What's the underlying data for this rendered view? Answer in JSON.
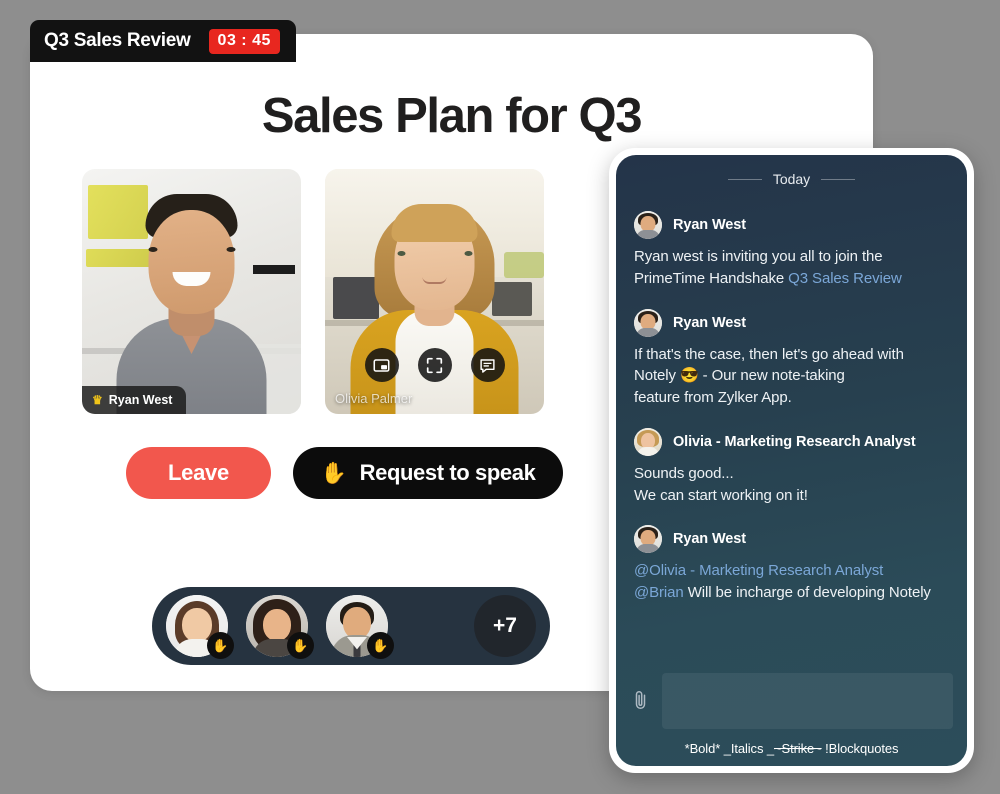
{
  "window": {
    "title": "Q3 Sales Review",
    "timer": "03 : 45"
  },
  "main": {
    "page_title": "Sales Plan for Q3",
    "tiles": [
      {
        "name": "Ryan West",
        "is_host": true,
        "host_icon": "crown-icon"
      },
      {
        "name": "Olivia Palmer",
        "is_host": false
      }
    ],
    "tile_controls": [
      {
        "icon": "picture-in-picture-icon",
        "label": "Picture in picture"
      },
      {
        "icon": "fullscreen-icon",
        "label": "Fullscreen"
      },
      {
        "icon": "chat-icon",
        "label": "Chat"
      }
    ],
    "actions": {
      "leave_label": "Leave",
      "request_label": "Request to speak",
      "request_icon": "raised-hand-icon",
      "leave_color": "#f2574d",
      "request_color": "#0c0c0c"
    },
    "participants": {
      "raised_hand_icon": "raised-hand-icon",
      "overflow_label": "+7",
      "avatars": [
        {
          "name": "Participant 1",
          "hand_raised": true
        },
        {
          "name": "Participant 2",
          "hand_raised": true
        },
        {
          "name": "Participant 3",
          "hand_raised": true
        }
      ]
    }
  },
  "chat": {
    "date_divider": "Today",
    "messages": [
      {
        "author": "Ryan West",
        "avatar": "ryan",
        "text_before": "Ryan  west is inviting you all to join the PrimeTime Handshake ",
        "link": "Q3 Sales Review",
        "text_after": ""
      },
      {
        "author": "Ryan West",
        "avatar": "ryan",
        "line1": "If that's the case, then let's go ahead with",
        "emoji": "😎",
        "line2_a": "Notely ",
        "line2_b": " - Our new note-taking",
        "line3": "feature from Zylker App."
      },
      {
        "author": "Olivia - Marketing Research Analyst",
        "avatar": "olivia",
        "line1": "Sounds good...",
        "line2": "We can start working on it!"
      },
      {
        "author": "Ryan West",
        "avatar": "ryan",
        "mention1": "@Olivia - Marketing Research Analyst",
        "mention2": "@Brian",
        "rest": " Will be incharge of developing Notely"
      }
    ],
    "composer": {
      "placeholder": "",
      "value": "",
      "attach_icon": "paperclip-icon"
    },
    "format_hints": {
      "bold": "*Bold*",
      "italics": "_Italics _",
      "strike": "~Strike~",
      "blockquotes": "!Blockquotes"
    }
  }
}
